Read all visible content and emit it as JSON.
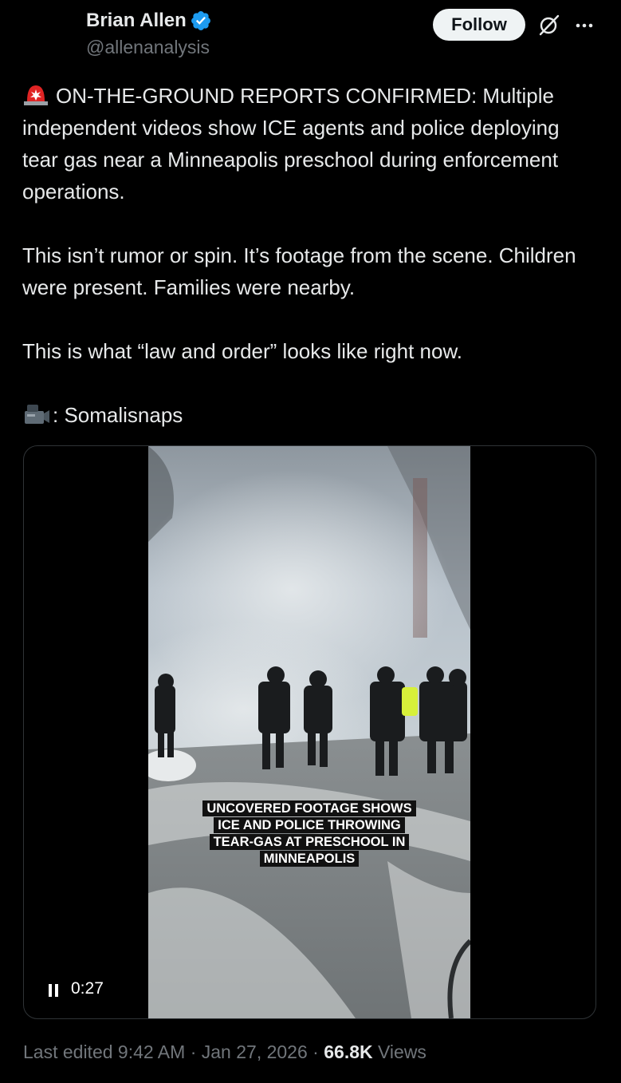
{
  "author": {
    "name": "Brian Allen",
    "handle": "@allenanalysis",
    "verified_color": "#1d9bf0"
  },
  "actions": {
    "follow_label": "Follow",
    "grok_icon": "grok-icon",
    "more_icon": "more-icon"
  },
  "post": {
    "paragraphs": [
      "ON-THE-GROUND REPORTS CONFIRMED: Multiple independent videos show ICE agents and police deploying tear gas near a Minneapolis preschool during enforcement operations.",
      "This isn’t rumor or spin. It’s footage from the scene. Children were present. Families were nearby.",
      "This is what “law and order” looks like right now.",
      ": Somalisnaps"
    ],
    "lead_emoji": "police-light-icon",
    "credit_emoji": "video-camera-icon"
  },
  "video": {
    "caption_lines": [
      "UNCOVERED FOOTAGE SHOWS",
      "ICE AND POLICE THROWING",
      "TEAR-GAS AT PRESCHOOL IN",
      "MINNEAPOLIS"
    ],
    "time": "0:27",
    "state": "playing"
  },
  "meta": {
    "edited": "Last edited 9:42 AM",
    "sep": "·",
    "date": "Jan 27, 2026",
    "views_count": "66.8K",
    "views_label": "Views"
  },
  "colors": {
    "background": "#000000",
    "text": "#e7e9ea",
    "secondary": "#71767b",
    "border": "#2f3336"
  }
}
